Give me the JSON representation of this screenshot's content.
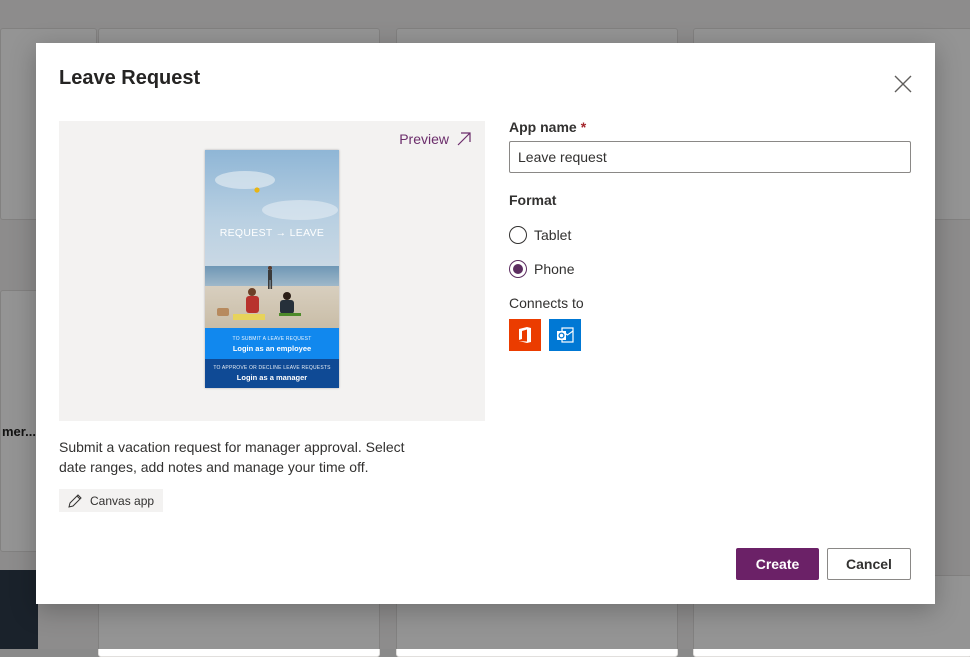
{
  "background": {
    "partial_card_title": "mer..."
  },
  "dialog": {
    "title": "Leave Request",
    "close_icon": "close-icon",
    "preview": {
      "link_label": "Preview",
      "link_icon": "arrow-up-right-icon",
      "phone": {
        "hero_text": "REQUEST → LEAVE",
        "employee_small": "TO SUBMIT A LEAVE REQUEST",
        "employee_big": "Login as an employee",
        "manager_small": "TO APPROVE OR DECLINE LEAVE REQUESTS",
        "manager_big": "Login as a manager"
      }
    },
    "description": "Submit a vacation request for manager approval. Select date ranges, add notes and manage your time off.",
    "tag": {
      "icon": "pen-icon",
      "label": "Canvas app"
    },
    "form": {
      "app_name_label": "App name",
      "required_marker": "*",
      "app_name_value": "Leave request",
      "format_label": "Format",
      "format_options": [
        {
          "label": "Tablet",
          "selected": false
        },
        {
          "label": "Phone",
          "selected": true
        }
      ],
      "connects_label": "Connects to",
      "connectors": [
        {
          "name": "office365-icon",
          "color": "#eb3c00"
        },
        {
          "name": "outlook-icon",
          "color": "#0078d4"
        }
      ]
    },
    "buttons": {
      "create": "Create",
      "cancel": "Cancel"
    }
  },
  "colors": {
    "primary": "#6b2167",
    "accent_text": "#6b2d6b",
    "required": "#a4262c"
  }
}
